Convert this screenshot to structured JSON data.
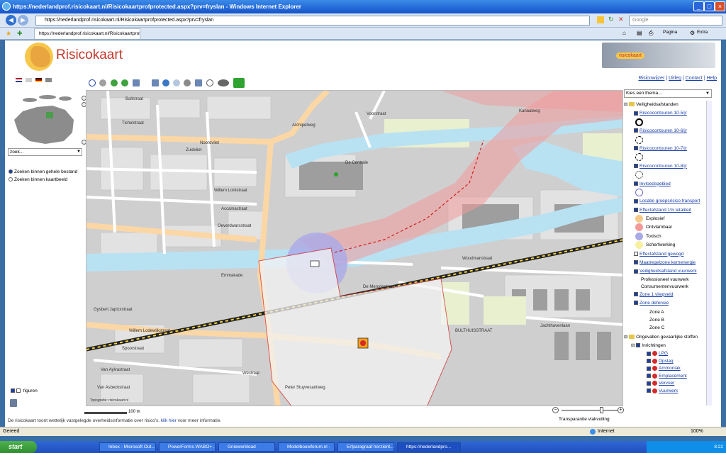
{
  "window": {
    "title": "https://nederlandprof.risicokaart.nl/Risicokaartprofprotected.aspx?prv=fryslan - Windows Internet Explorer"
  },
  "browser": {
    "url": "https://nederlandprof.risicokaart.nl/Risicokaartprofprotected.aspx?prv=fryslan",
    "search_placeholder": "Google",
    "tab_label": "https://nederlandprof.risicokaart.nl/Risicokaartprof...",
    "cmd_page": "Pagina",
    "cmd_extra": "Extra"
  },
  "header": {
    "brand": "Risicokaart",
    "logo_right_text": "risicokaart",
    "links": [
      "Risicowijzer",
      "Uitleg",
      "Contact",
      "Help"
    ]
  },
  "left": {
    "search_placeholder": "zoek...",
    "radio1": "Zoeken binnen gehele bestand",
    "radio2": "Zoeken binnen kaartbeeld",
    "figuren": "figuren"
  },
  "map": {
    "labels": {
      "centrale": "De Centrale",
      "ballstraat": "Ballstraat",
      "tichelstraat": "Tichelstraat",
      "noordvliet": "Noordvliet",
      "zuidvliet": "Zuidvliet",
      "willem_lorestraat": "Willem Loréstraat",
      "accamastraat": "Accamastraat",
      "oeverdwarsstraat": "Oeverdwarsstraat",
      "emmakade": "Emmakade",
      "de_merodestraat": "De Merodestraat",
      "willem_lodewijkstraat": "Willem Lodewijkstraat",
      "spoorstraat": "Spoorstraat",
      "van_aylvastraat": "Van Aylvastraat",
      "bulthuisstraat": "BULTHUISSTRAAT",
      "jachthavenlaan": "Jachthavenlaan",
      "kanaalweg": "Kanaalweg",
      "voorstraat": "Voorstraat",
      "woudmanstraat": "Woudmanstraat",
      "westraat": "Westraat",
      "gysbert": "Gysbert Japicxstraat",
      "peter_stuyvesantweg": "Peter Stuyvesantweg",
      "van_asbeckstraat": "Van Asbeckstraat",
      "archipelweg": "Archipelweg",
      "copyright": "Topografie: risicokaart.nl"
    },
    "status_text": "De risicokaart toont wettelijk vastgelegde overheidsinformatie over risico's.",
    "status_link": "klik hier",
    "status_tail": "voor meer informatie.",
    "scale": "100 m",
    "transparency_label": "Transparantie vlakvulling"
  },
  "legend": {
    "thema_placeholder": "Kies een thema...",
    "group1": "Veiligheidsafstanden",
    "items": [
      {
        "label": "Risicocontouren 10-5/jr",
        "checked": true,
        "sym": "ring-black"
      },
      {
        "label": "Risicocontouren 10-6/jr",
        "checked": true,
        "sym": "ring-dash"
      },
      {
        "label": "Risicocontouren 10-7/jr",
        "checked": true,
        "sym": "ring-dash"
      },
      {
        "label": "Risicocontouren 10-8/jr",
        "checked": true,
        "sym": "ring-dot"
      },
      {
        "label": "Invloedsgebied",
        "checked": true,
        "sym": "ring-blue"
      },
      {
        "label": "Locatie groepsrisico transport",
        "checked": true,
        "sym": ""
      },
      {
        "label": "Effectafstand 1% letaliteit",
        "checked": true,
        "sym": ""
      }
    ],
    "effects": [
      {
        "label": "Explosief",
        "color": "#f5c98a"
      },
      {
        "label": "Ontvlambaar",
        "color": "#f29a9a"
      },
      {
        "label": "Toxisch",
        "color": "#a9a9e8"
      },
      {
        "label": "Scherfwerking",
        "color": "#f7f0a0"
      }
    ],
    "items2": [
      {
        "label": "Effectafstand gewogd",
        "checked": false
      },
      {
        "label": "Maatregelzone kernenergie",
        "checked": true
      },
      {
        "label": "Veiligheidsafstand vuurwerk",
        "checked": true
      }
    ],
    "vuurwerk": [
      "Professioneel vuurwerk",
      "Consumentenvuurwerk"
    ],
    "items3": [
      {
        "label": "Zone 1 vliegveld",
        "checked": true
      },
      {
        "label": "Zone defensie",
        "checked": true
      }
    ],
    "zones": [
      "Zone A",
      "Zone B",
      "Zone C"
    ],
    "group2": "Ongevallen gevaarlijke stoffen",
    "group3": "Inrichtingen",
    "inrichtingen": [
      {
        "label": "LPG",
        "color": "#d42a2a"
      },
      {
        "label": "Opslag",
        "color": "#d42a2a"
      },
      {
        "label": "Ammoniak",
        "color": "#d42a2a"
      },
      {
        "label": "Emplacement",
        "color": "#d42a2a"
      },
      {
        "label": "Vervoer",
        "color": "#d42a2a"
      },
      {
        "label": "Vuurwerk",
        "color": "#d42a2a"
      }
    ]
  },
  "status": {
    "left": "Gereed",
    "zone": "Internet",
    "zoom": "100%"
  },
  "taskbar": {
    "start": "start",
    "tasks": [
      "Inbox - Microsoft Out...",
      "PowerForms WABO+ ...",
      "Gnieworkload",
      "Modelbouwforum.nl -",
      "Erfparagraaf herzient...",
      "https://nederlandpro..."
    ],
    "clock": "8:22"
  }
}
